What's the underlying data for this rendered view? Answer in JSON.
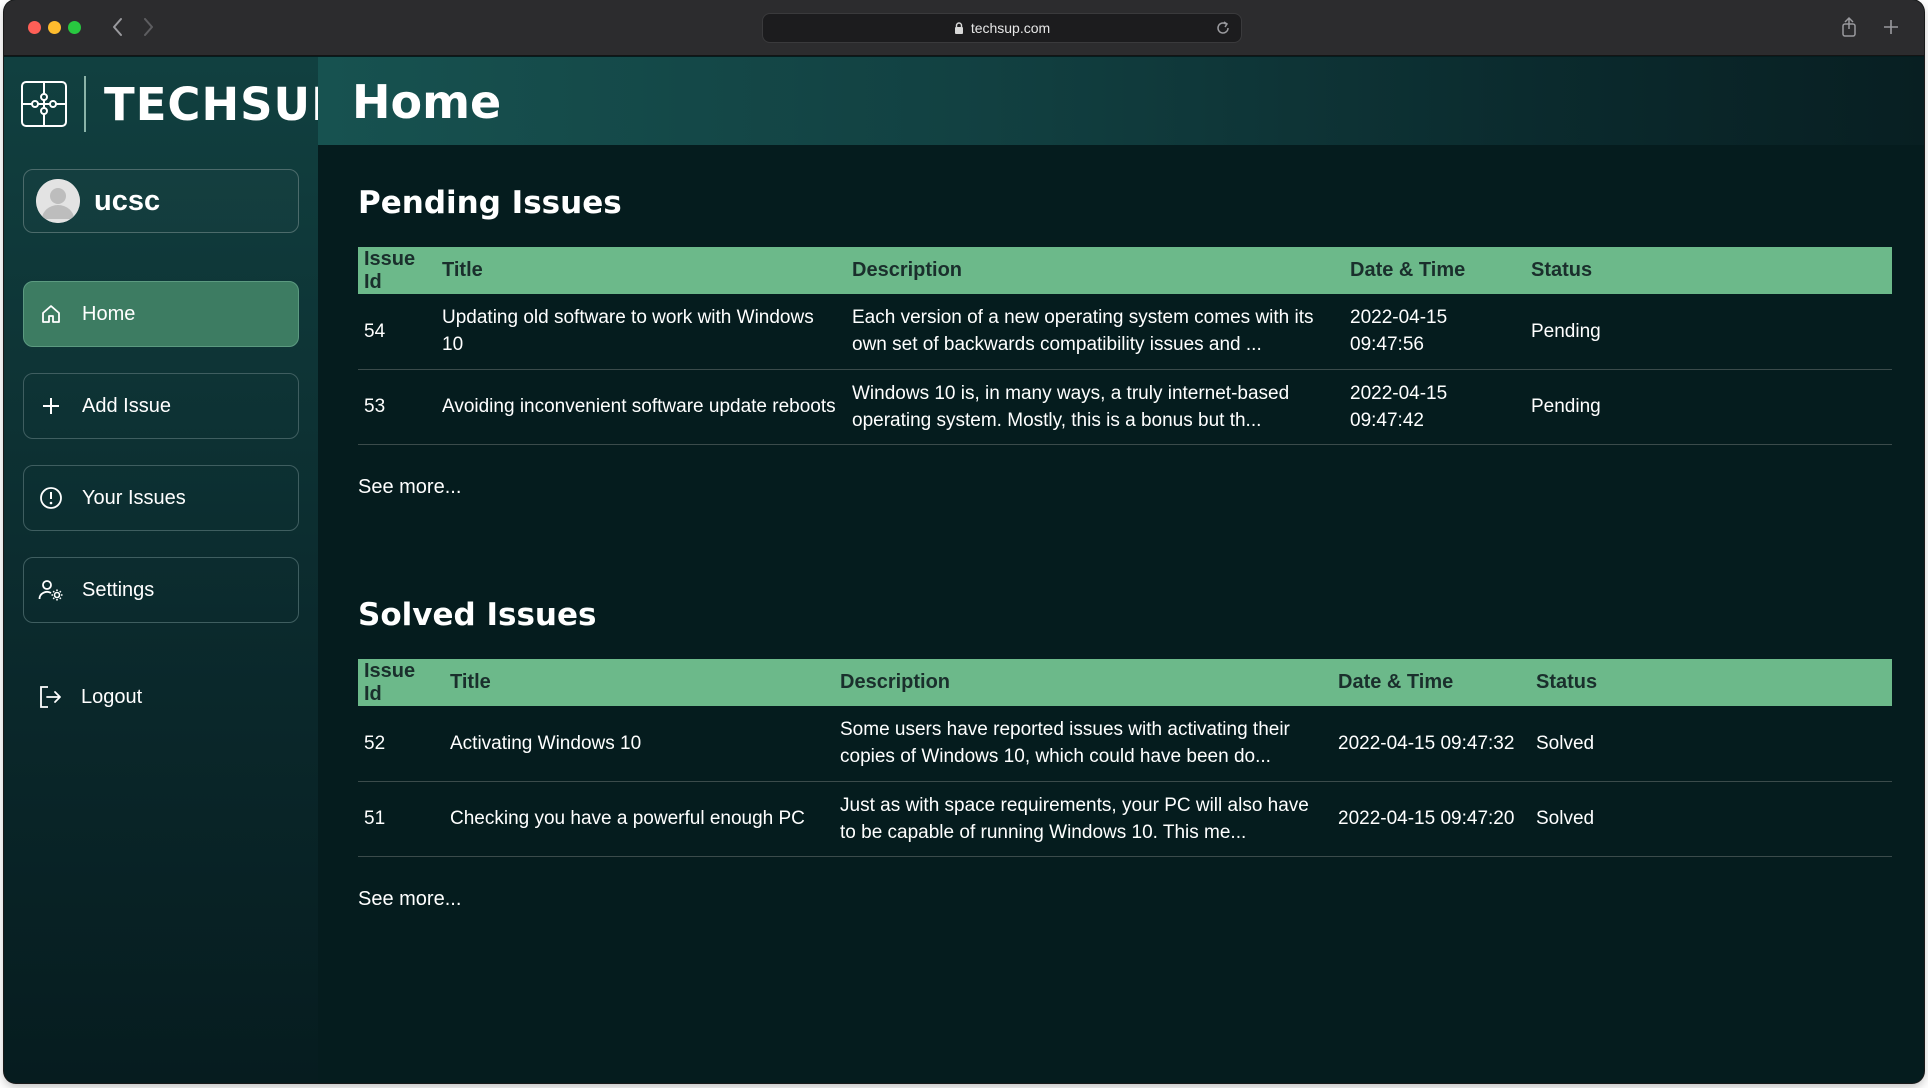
{
  "browser": {
    "url": "techsup.com"
  },
  "brand": {
    "name": "TECHSUP"
  },
  "user": {
    "name": "ucsc"
  },
  "sidebar": {
    "items": [
      {
        "label": "Home",
        "icon": "home-icon",
        "active": true
      },
      {
        "label": "Add Issue",
        "icon": "plus-icon",
        "active": false
      },
      {
        "label": "Your Issues",
        "icon": "alert-circle-icon",
        "active": false
      },
      {
        "label": "Settings",
        "icon": "user-gear-icon",
        "active": false
      }
    ],
    "logout_label": "Logout"
  },
  "header": {
    "title": "Home"
  },
  "pending": {
    "title": "Pending Issues",
    "columns": [
      "Issue Id",
      "Title",
      "Description",
      "Date & Time",
      "Status"
    ],
    "rows": [
      {
        "id": "54",
        "title": "Updating old software to work with Windows 10",
        "description": "Each version of a new operating system comes with its own set of backwards compatibility issues and ...",
        "datetime": "2022-04-15 09:47:56",
        "status": "Pending"
      },
      {
        "id": "53",
        "title": "Avoiding inconvenient software update reboots",
        "description": "Windows 10 is, in many ways, a truly internet-based operating system. Mostly, this is a bonus but th...",
        "datetime": "2022-04-15 09:47:42",
        "status": "Pending"
      }
    ],
    "see_more": "See more..."
  },
  "solved": {
    "title": "Solved Issues",
    "columns": [
      "Issue Id",
      "Title",
      "Description",
      "Date & Time",
      "Status"
    ],
    "rows": [
      {
        "id": "52",
        "title": "Activating Windows 10",
        "description": "Some users have reported issues with activating their copies of Windows 10, which could have been do...",
        "datetime": "2022-04-15 09:47:32",
        "status": "Solved"
      },
      {
        "id": "51",
        "title": "Checking you have a powerful enough PC",
        "description": "Just as with space requirements, your PC will also have to be capable of running Windows 10. This me...",
        "datetime": "2022-04-15 09:47:20",
        "status": "Solved"
      }
    ],
    "see_more": "See more..."
  },
  "colors": {
    "accent_green": "#6cb98a",
    "active_nav": "#3d7c62",
    "background": "#051c1e"
  }
}
